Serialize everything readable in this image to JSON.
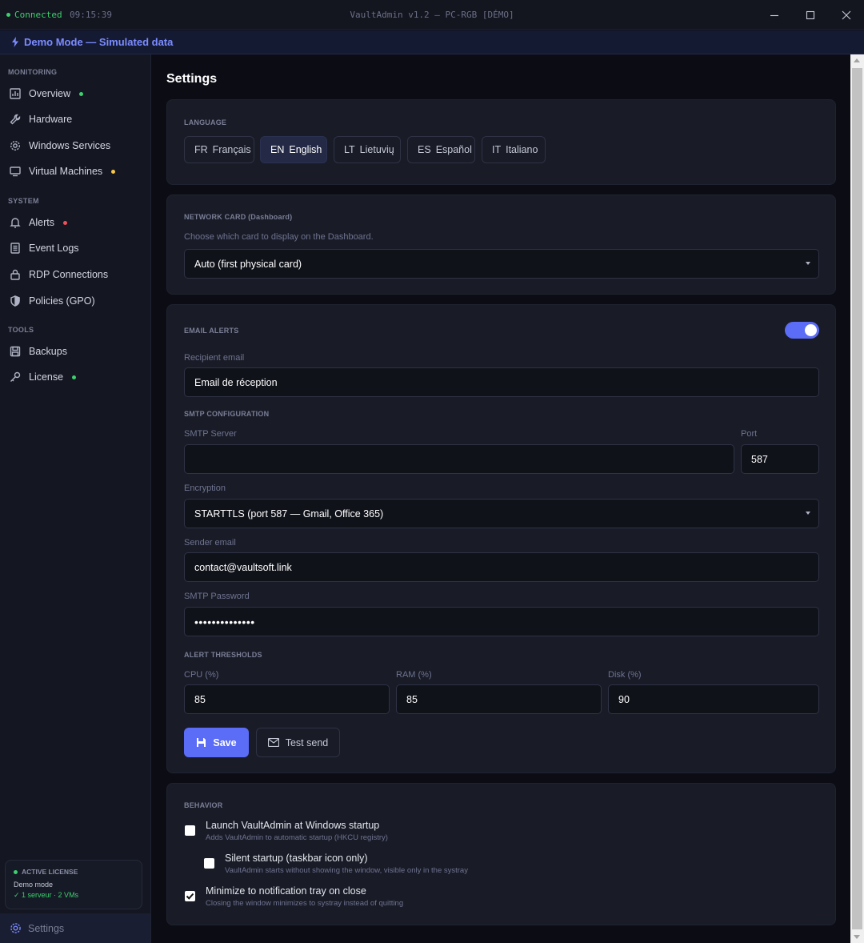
{
  "titlebar": {
    "status": "Connected",
    "time": "09:15:39",
    "title": "VaultAdmin v1.2 — PC-RGB [DÉMO]"
  },
  "banner": {
    "text": "Demo Mode — Simulated data"
  },
  "sidebar": {
    "sections": {
      "monitoring": "MONITORING",
      "system": "SYSTEM",
      "tools": "TOOLS"
    },
    "items": [
      {
        "label": "Overview",
        "icon": "chart-icon",
        "dot": "#3ecf6e"
      },
      {
        "label": "Hardware",
        "icon": "wrench-icon",
        "dot": null
      },
      {
        "label": "Windows Services",
        "icon": "gear-icon",
        "dot": null
      },
      {
        "label": "Virtual Machines",
        "icon": "monitor-icon",
        "dot": "#f5c84b"
      },
      {
        "label": "Alerts",
        "icon": "bell-icon",
        "dot": "#f0505a"
      },
      {
        "label": "Event Logs",
        "icon": "document-icon",
        "dot": null
      },
      {
        "label": "RDP Connections",
        "icon": "lock-icon",
        "dot": null
      },
      {
        "label": "Policies (GPO)",
        "icon": "shield-icon",
        "dot": null
      },
      {
        "label": "Backups",
        "icon": "save-icon",
        "dot": null
      },
      {
        "label": "License",
        "icon": "key-icon",
        "dot": "#3ecf6e"
      }
    ],
    "license": {
      "title": "ACTIVE LICENSE",
      "mode": "Demo mode",
      "info": "✓ 1 serveur · 2 VMs"
    },
    "settings_label": "Settings"
  },
  "main": {
    "title": "Settings",
    "language": {
      "label": "LANGUAGE",
      "options": [
        {
          "code": "FR",
          "name": "Français"
        },
        {
          "code": "EN",
          "name": "English"
        },
        {
          "code": "LT",
          "name": "Lietuvių"
        },
        {
          "code": "ES",
          "name": "Español"
        },
        {
          "code": "IT",
          "name": "Italiano"
        }
      ],
      "selected": "EN"
    },
    "network": {
      "label": "NETWORK CARD (Dashboard)",
      "help": "Choose which card to display on the Dashboard.",
      "selected": "Auto (first physical card)"
    },
    "email": {
      "label": "EMAIL ALERTS",
      "enabled": true,
      "recipient_label": "Recipient email",
      "recipient_value": "Email de réception",
      "smtp_label": "SMTP CONFIGURATION",
      "server_label": "SMTP Server",
      "server_value": "",
      "port_label": "Port",
      "port_value": "587",
      "encryption_label": "Encryption",
      "encryption_value": "STARTTLS (port 587 — Gmail, Office 365)",
      "sender_label": "Sender email",
      "sender_value": "contact@vaultsoft.link",
      "password_label": "SMTP Password",
      "password_value": "••••••••••••••",
      "thresholds_label": "ALERT THRESHOLDS",
      "cpu_label": "CPU (%)",
      "cpu_value": "85",
      "ram_label": "RAM (%)",
      "ram_value": "85",
      "disk_label": "Disk (%)",
      "disk_value": "90",
      "save_label": "Save",
      "test_label": "Test send"
    },
    "behavior": {
      "label": "BEHAVIOR",
      "options": [
        {
          "title": "Launch VaultAdmin at Windows startup",
          "sub": "Adds VaultAdmin to automatic startup (HKCU registry)",
          "checked": false
        },
        {
          "title": "Silent startup (taskbar icon only)",
          "sub": "VaultAdmin starts without showing the window, visible only in the systray",
          "checked": false
        },
        {
          "title": "Minimize to notification tray on close",
          "sub": "Closing the window minimizes to systray instead of quitting",
          "checked": true
        }
      ]
    }
  }
}
